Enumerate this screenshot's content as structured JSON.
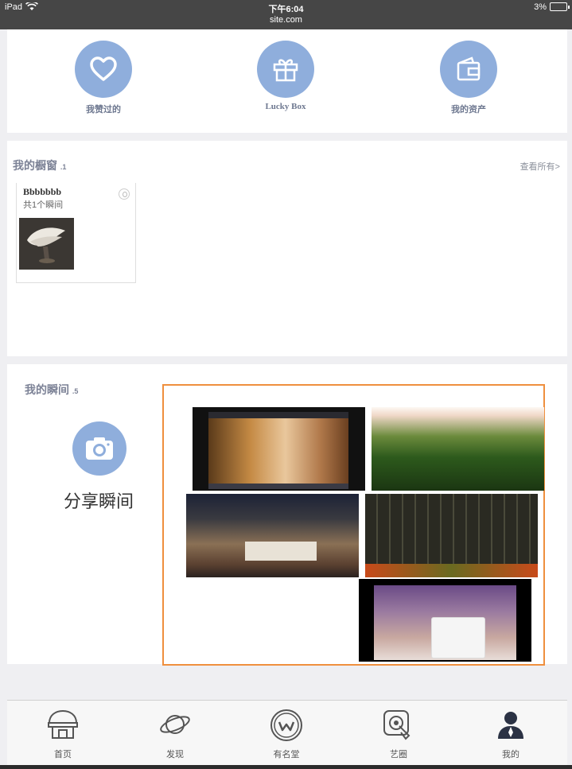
{
  "status_bar": {
    "device": "iPad",
    "time": "下午6:04",
    "url": "site.com",
    "battery": "3%"
  },
  "quick_actions": [
    {
      "label": "我赞过的",
      "icon": "heart-icon"
    },
    {
      "label": "Lucky Box",
      "icon": "gift-icon"
    },
    {
      "label": "我的资产",
      "icon": "wallet-icon"
    }
  ],
  "window_section": {
    "title": "我的橱窗",
    "count": ".1",
    "see_all": "查看所有>",
    "card": {
      "title": "Bbbbbbb",
      "subtitle": "共1个瞬间"
    }
  },
  "moments_section": {
    "title": "我的瞬间",
    "count": ".5",
    "share_label": "分享瞬间",
    "accent_color": "#ef8f3e",
    "photos": 5
  },
  "tabbar": [
    {
      "label": "首页",
      "icon": "home-icon"
    },
    {
      "label": "发现",
      "icon": "planet-icon"
    },
    {
      "label": "有名堂",
      "icon": "logo-w-icon"
    },
    {
      "label": "艺圈",
      "icon": "touch-icon"
    },
    {
      "label": "我的",
      "icon": "user-icon"
    }
  ],
  "colors": {
    "icon_circle": "#8faedc",
    "status_bar": "#464646"
  }
}
